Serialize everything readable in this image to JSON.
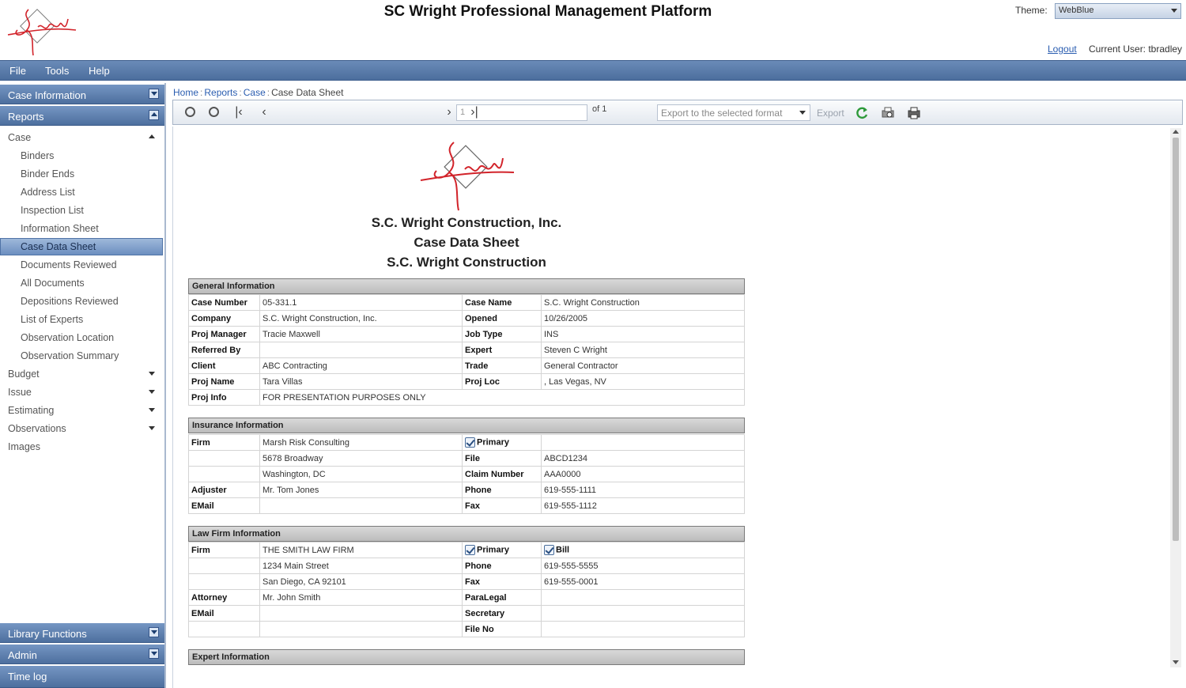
{
  "app": {
    "title": "SC Wright Professional Management Platform",
    "theme_label": "Theme:",
    "theme_value": "WebBlue",
    "logout_label": "Logout",
    "current_user": "Current User: tbradley"
  },
  "menu": {
    "items": [
      "File",
      "Tools",
      "Help"
    ]
  },
  "sidebar": {
    "panels": {
      "case_information": "Case Information",
      "reports": "Reports",
      "library_functions": "Library Functions",
      "admin": "Admin",
      "time_log": "Time log"
    },
    "tree": {
      "case": "Case",
      "case_items": [
        "Binders",
        "Binder Ends",
        "Address List",
        "Inspection List",
        "Information Sheet",
        "Case Data Sheet",
        "Documents Reviewed",
        "All Documents",
        "Depositions Reviewed",
        "List of Experts",
        "Observation Location",
        "Observation Summary"
      ],
      "groups": [
        "Budget",
        "Issue",
        "Estimating",
        "Observations"
      ],
      "images": "Images"
    },
    "selected_item": "Case Data Sheet"
  },
  "breadcrumb": [
    "Home",
    "Reports",
    "Case",
    "Case Data Sheet"
  ],
  "toolbar": {
    "page_number": "1",
    "page_of": "of 1",
    "export_format_placeholder": "Export to the selected format",
    "export_label": "Export",
    "icons": [
      "back-icon",
      "forward-icon",
      "first-page-icon",
      "previous-page-icon",
      "next-page-icon",
      "last-page-icon",
      "refresh-icon",
      "print-preview-icon",
      "print-icon"
    ]
  },
  "report": {
    "company": "S.C. Wright Construction, Inc.",
    "title": "Case Data Sheet",
    "subtitle": "S.C. Wright Construction",
    "general": {
      "header": "General Information",
      "rows": [
        [
          "Case Number",
          "05-331.1",
          "Case Name",
          "S.C. Wright Construction"
        ],
        [
          "Company",
          "S.C. Wright Construction, Inc.",
          "Opened",
          "10/26/2005"
        ],
        [
          "Proj Manager",
          "Tracie Maxwell",
          "Job Type",
          "INS"
        ],
        [
          "Referred By",
          "",
          "Expert",
          "Steven C Wright"
        ],
        [
          "Client",
          "ABC Contracting",
          "Trade",
          "General Contractor"
        ],
        [
          "Proj Name",
          "Tara Villas",
          "Proj Loc",
          ", Las Vegas, NV"
        ],
        [
          "Proj Info",
          "FOR PRESENTATION PURPOSES ONLY"
        ]
      ]
    },
    "insurance": {
      "header": "Insurance Information",
      "primary_label": "Primary",
      "rows": [
        [
          "Firm",
          "Marsh Risk Consulting",
          "",
          ""
        ],
        [
          "",
          "5678 Broadway",
          "File",
          "ABCD1234"
        ],
        [
          "",
          "Washington, DC",
          "Claim Number",
          "AAA0000"
        ],
        [
          "Adjuster",
          "Mr. Tom Jones",
          "Phone",
          "619-555-1111"
        ],
        [
          "EMail",
          "",
          "Fax",
          "619-555-1112"
        ]
      ]
    },
    "law_firm": {
      "header": "Law Firm Information",
      "primary_label": "Primary",
      "bill_label": "Bill",
      "rows": [
        [
          "Firm",
          "THE SMITH LAW FIRM",
          "",
          ""
        ],
        [
          "",
          "1234 Main Street",
          "Phone",
          "619-555-5555"
        ],
        [
          "",
          "San Diego, CA 92101",
          "Fax",
          "619-555-0001"
        ],
        [
          "Attorney",
          "Mr. John Smith",
          "ParaLegal",
          ""
        ],
        [
          "EMail",
          "",
          "Secretary",
          ""
        ],
        [
          "",
          "",
          "File No",
          ""
        ]
      ]
    },
    "expert": {
      "header": "Expert Information"
    }
  }
}
